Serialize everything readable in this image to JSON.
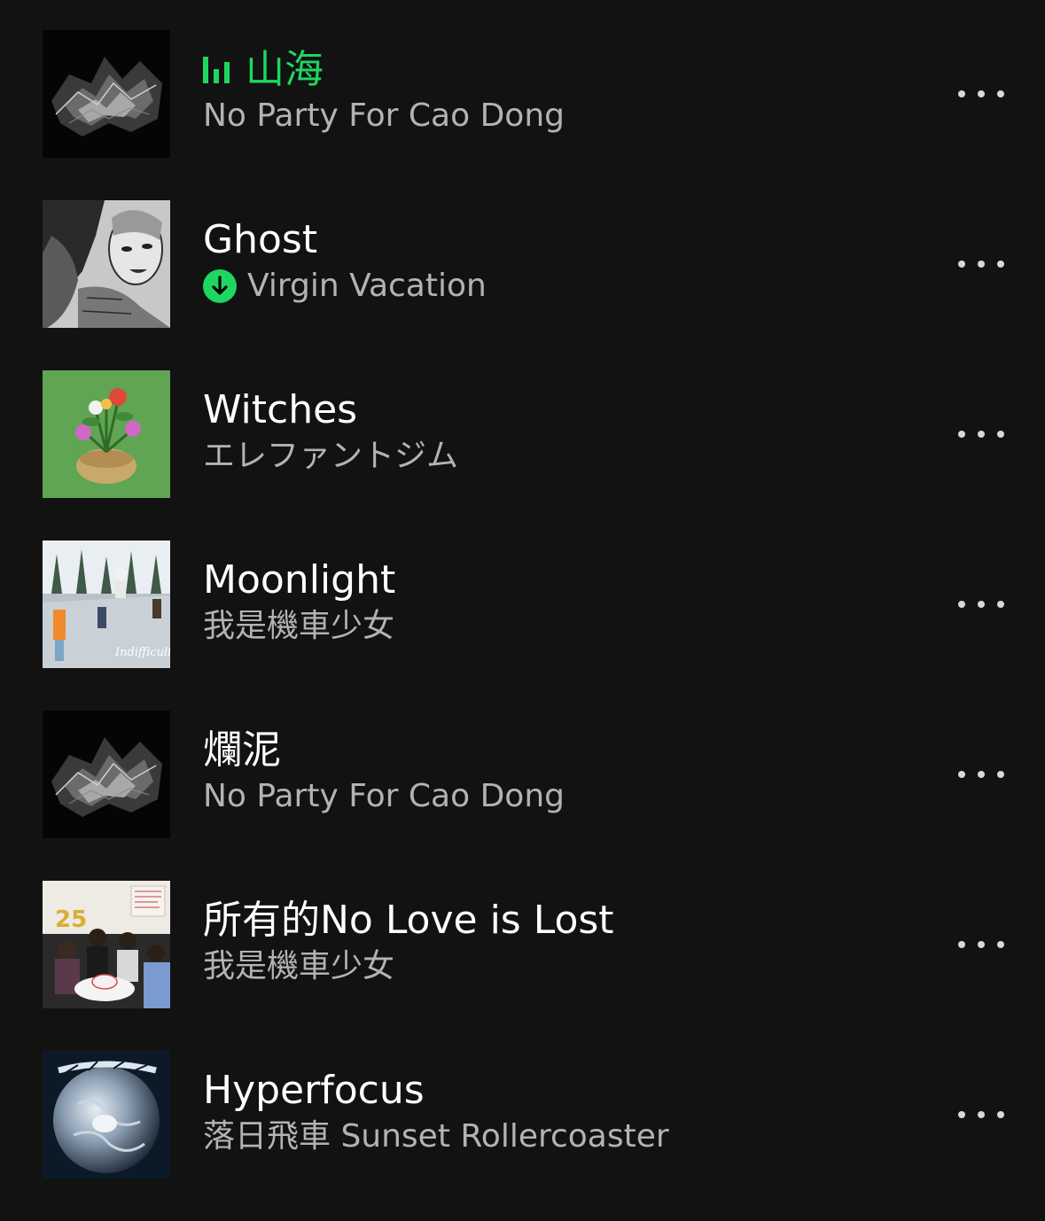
{
  "colors": {
    "background": "#121212",
    "accent": "#1ed760",
    "primary_text": "#ffffff",
    "secondary_text": "#b3b3b3"
  },
  "tracks": [
    {
      "title": "山海",
      "artist": "No Party For Cao Dong",
      "now_playing": true,
      "downloaded": false,
      "cover": "dark-crystal-art-cover",
      "more_icon": "more-options-icon"
    },
    {
      "title": "Ghost",
      "artist": "Virgin Vacation",
      "now_playing": false,
      "downloaded": true,
      "cover": "manga-faces-cover",
      "more_icon": "more-options-icon"
    },
    {
      "title": "Witches",
      "artist": "エレファントジム",
      "now_playing": false,
      "downloaded": false,
      "cover": "flower-pot-green-cover",
      "more_icon": "more-options-icon"
    },
    {
      "title": "Moonlight",
      "artist": "我是機車少女",
      "now_playing": false,
      "downloaded": false,
      "cover": "pool-photo-cover",
      "more_icon": "more-options-icon"
    },
    {
      "title": "爛泥",
      "artist": "No Party For Cao Dong",
      "now_playing": false,
      "downloaded": false,
      "cover": "dark-crystal-art-cover",
      "more_icon": "more-options-icon"
    },
    {
      "title": "所有的No Love is Lost",
      "artist": "我是機車少女",
      "now_playing": false,
      "downloaded": false,
      "cover": "birthday-photo-cover",
      "more_icon": "more-options-icon"
    },
    {
      "title": "Hyperfocus",
      "artist": "落日飛車 Sunset Rollercoaster",
      "now_playing": false,
      "downloaded": false,
      "cover": "globe-cover",
      "more_icon": "more-options-icon"
    }
  ]
}
